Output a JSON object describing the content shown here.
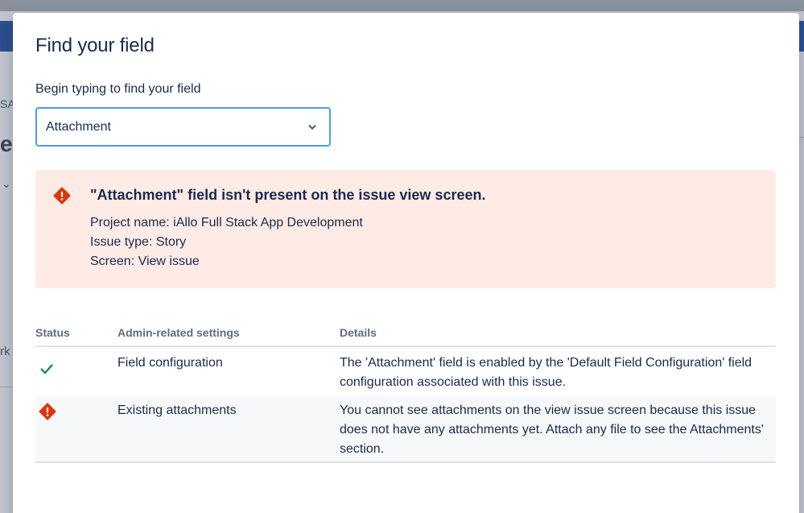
{
  "modal": {
    "title": "Find your field",
    "field_label": "Begin typing to find your field",
    "select_value": "Attachment"
  },
  "banner": {
    "title": "\"Attachment\" field isn't present on the issue view screen.",
    "lines": [
      "Project name: iAllo Full Stack App Development",
      "Issue type: Story",
      "Screen: View issue"
    ]
  },
  "table": {
    "headers": [
      "Status",
      "Admin-related settings",
      "Details"
    ],
    "rows": [
      {
        "status_icon": "check-icon",
        "setting": "Field configuration",
        "details": "The 'Attachment' field is enabled by the 'Default Field Configuration' field configuration associated with this issue."
      },
      {
        "status_icon": "error-icon",
        "setting": "Existing attachments",
        "details": "You cannot see attachments on the view issue screen because this issue does not have any attachments yet. Attach any file to see the Attachments' section."
      }
    ]
  },
  "background": {
    "fragments_left": [
      "SA",
      "e",
      "rk"
    ]
  },
  "colors": {
    "accent_border": "#4c9aff",
    "error_bg": "#ffebe6",
    "error_icon": "#de350b",
    "success_icon": "#00875a",
    "text": "#172b4d",
    "subtle_text": "#5e6c84"
  }
}
